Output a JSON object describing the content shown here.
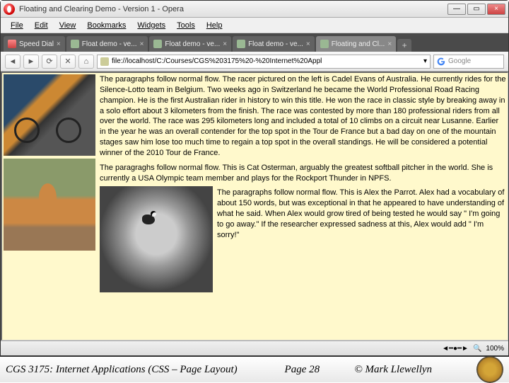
{
  "window": {
    "title": "Floating and Clearing Demo - Version 1 - Opera",
    "min": "—",
    "max": "▭",
    "close": "×"
  },
  "menu": [
    "File",
    "Edit",
    "View",
    "Bookmarks",
    "Widgets",
    "Tools",
    "Help"
  ],
  "tabs": [
    {
      "label": "Speed Dial",
      "kind": "sd"
    },
    {
      "label": "Float demo - ve..."
    },
    {
      "label": "Float demo - ve..."
    },
    {
      "label": "Float demo - ve..."
    },
    {
      "label": "Floating and Cl...",
      "active": true
    }
  ],
  "nav": {
    "back": "◄",
    "fwd": "►",
    "reload": "⟳",
    "stop": "✕",
    "home": "⌂",
    "url": "file://localhost/C:/Courses/CGS%203175%20-%20Internet%20Appl",
    "search_placeholder": "Google"
  },
  "paragraphs": {
    "p1": "The paragraphs follow normal flow. The racer pictured on the left is Cadel Evans of Australia. He currently rides for the Silence-Lotto team in Belgium. Two weeks ago in Switzerland he became the World Professional Road Racing champion. He is the first Australian rider in history to win this title. He won the race in classic style by breaking away in a solo effort about 3 kilometers from the finish. The race was contested by more than 180 professional riders from all over the world. The race was 295 kilometers long and included a total of 10 climbs on a circuit near Lusanne. Earlier in the year he was an overall contender for the top spot in the Tour de France but a bad day on one of the mountain stages saw him lose too much time to regain a top spot in the overall standings. He will be considered a potential winner of the 2010 Tour de France.",
    "p2": "The paragraghs follow normal flow. This is Cat Osterman, arguably the greatest softball pitcher in the world. She is currently a USA Olympic team member and plays for the Rockport Thunder in NPFS.",
    "p3": "The paragraphs follow normal flow. This is Alex the Parrot. Alex had a vocabulary of about 150 words, but was exceptional in that he appeared to have understanding of what he said. When Alex would grow tired of being tested he would say \" I'm going to go away.\" If the researcher expressed sadness at this, Alex would add \" I'm sorry!\""
  },
  "status": {
    "zoom": "100%",
    "zoom_icon": "🔍"
  },
  "footer": {
    "course": "CGS 3175: Internet Applications (CSS – Page Layout)",
    "page": "Page 28",
    "author": "© Mark Llewellyn"
  }
}
